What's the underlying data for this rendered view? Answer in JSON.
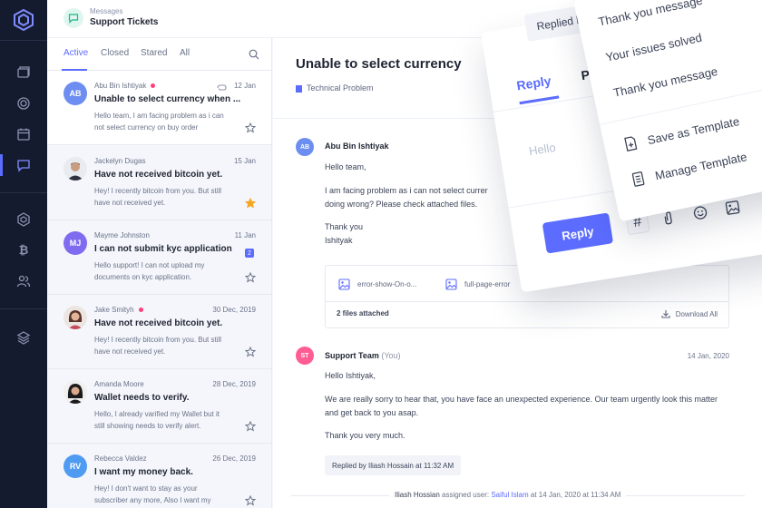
{
  "header": {
    "breadcrumb": "Messages",
    "title": "Support Tickets"
  },
  "tabs": [
    "Active",
    "Closed",
    "Stared",
    "All"
  ],
  "tickets": [
    {
      "initials": "AB",
      "name": "Abu Bin Ishtiyak",
      "online": true,
      "attachment": true,
      "date": "12 Jan",
      "subject": "Unable to select currency when ...",
      "preview": "Hello team, I am facing problem as i can not select currency on buy order",
      "starred": false,
      "color": "#6d8df0",
      "selected": true
    },
    {
      "initials": "",
      "name": "Jackelyn Dugas",
      "online": false,
      "date": "15 Jan",
      "subject": "Have not received bitcoin yet.",
      "preview": "Hey! I recently bitcoin from you. But still have not received yet.",
      "starred": true,
      "photo": "man"
    },
    {
      "initials": "MJ",
      "name": "Mayme Johnston",
      "online": false,
      "date": "11 Jan",
      "subject": "I can not submit kyc application",
      "preview": "Hello support! I can not upload my documents on kyc application.",
      "starred": false,
      "badge": "2",
      "color": "#7e6cf0"
    },
    {
      "initials": "",
      "name": "Jake Smityh",
      "online": true,
      "date": "30 Dec, 2019",
      "subject": "Have not received bitcoin yet.",
      "preview": "Hey! I recently bitcoin from you. But still have not received yet.",
      "starred": false,
      "photo": "woman1"
    },
    {
      "initials": "",
      "name": "Amanda Moore",
      "online": false,
      "date": "28 Dec, 2019",
      "subject": "Wallet needs to verify.",
      "preview": "Hello, I already varified my Wallet but it still showing needs to verify alert.",
      "starred": false,
      "photo": "woman2"
    },
    {
      "initials": "RV",
      "name": "Rebecca Valdez",
      "online": false,
      "date": "26 Dec, 2019",
      "subject": "I want my money back.",
      "preview": "Hey! I don't want to stay as your subscriber any more, Also I want my",
      "starred": false,
      "color": "#4f9bf2"
    }
  ],
  "conversation": {
    "title": "Unable to select currency",
    "tag": "Technical Problem",
    "message1": {
      "initials": "AB",
      "author": "Abu Bin Ishtiyak",
      "greeting": "Hello team,",
      "body1": "I am facing problem as i can not select currer",
      "body2": "doing wrong? Please check attached files.",
      "thanks": "Thank you",
      "sign": "Ishityak"
    },
    "attachments": {
      "file1": "error-show-On-o...",
      "file2": "full-page-error",
      "count": "2 files attached",
      "download": "Download All"
    },
    "message2": {
      "initials": "ST",
      "author": "Support Team",
      "author_suffix": "(You)",
      "date": "14 Jan, 2020",
      "greeting": "Hello Ishtiyak,",
      "body1": "We are really sorry to hear that, you have face an unexpected experience. Our team urgently look this matter",
      "body2": "and get back to you asap.",
      "thanks": "Thank you very much.",
      "replied": "Replied by Iliash Hossain at 11:32 AM"
    },
    "assign": {
      "who": "Iliash Hossian",
      "text": "assigned user:",
      "user": "Saiful Islam",
      "when": "at 14 Jan, 2020 at 11:34 AM"
    }
  },
  "reply_box": {
    "replied_by": "Replied by",
    "tab_reply": "Reply",
    "tab_private": "Private",
    "placeholder": "Hello",
    "button": "Reply",
    "hash": "#"
  },
  "template_menu": {
    "items": [
      "Thank you message",
      "Your issues solved",
      "Thank you message"
    ],
    "save": "Save as Template",
    "manage": "Manage Template"
  },
  "colors": {
    "accent": "#5b6cff",
    "rail": "#151b2e",
    "online": "#ff3f7d",
    "star_active": "#f5a623"
  }
}
